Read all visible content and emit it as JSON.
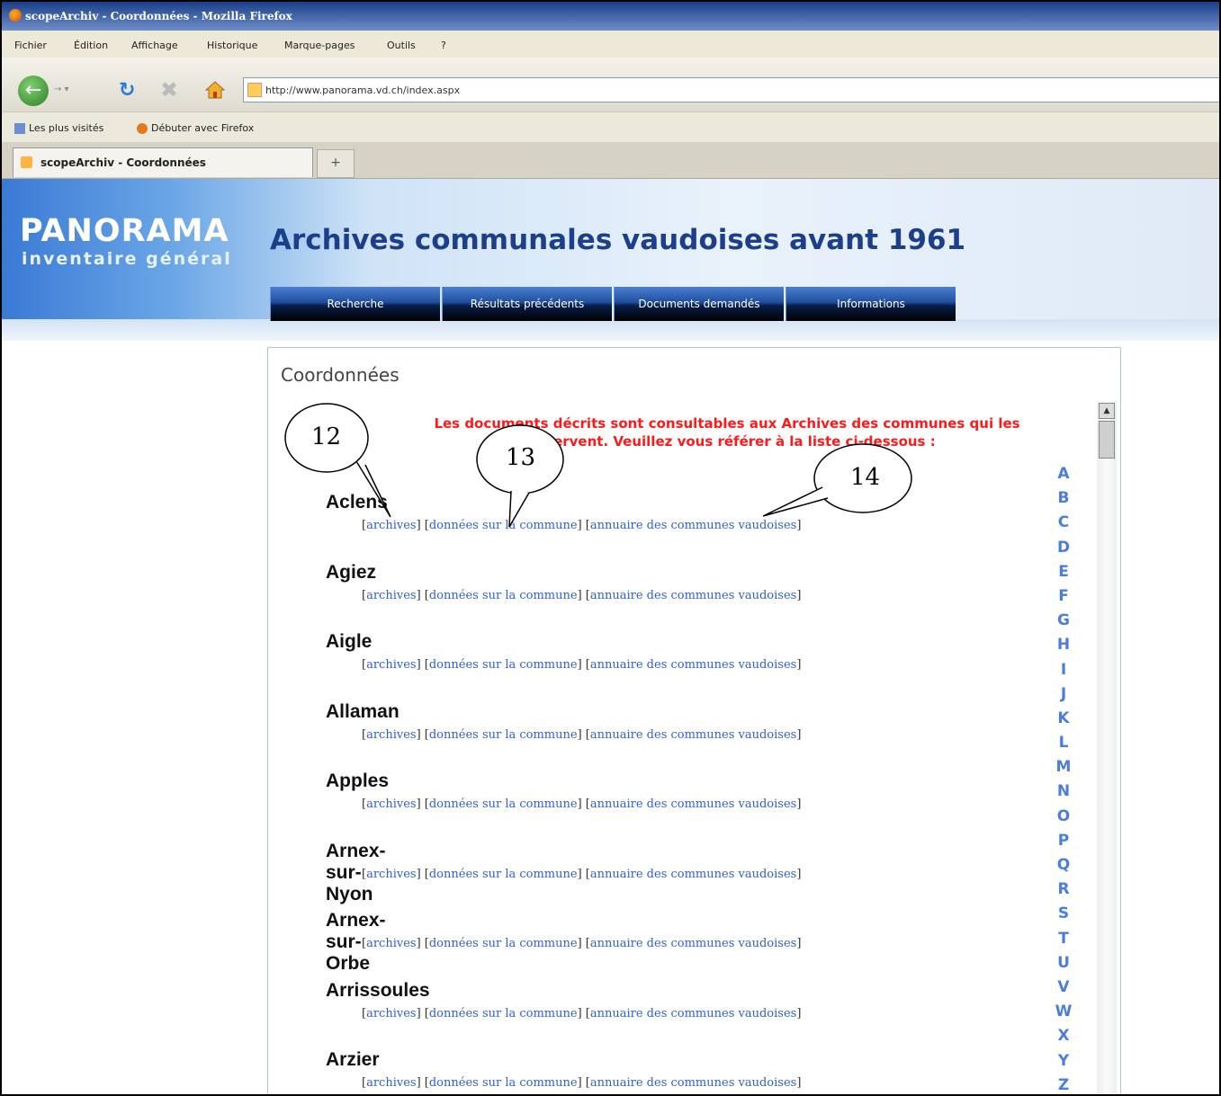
{
  "browser": {
    "window_title": "scopeArchiv - Coordonnées - Mozilla Firefox",
    "menu": [
      "Fichier",
      "Édition",
      "Affichage",
      "Historique",
      "Marque-pages",
      "Outils",
      "?"
    ],
    "url": "http://www.panorama.vd.ch/index.aspx",
    "bookmarks": [
      "Les plus visités",
      "Débuter avec Firefox"
    ],
    "tab_label": "scopeArchiv - Coordonnées",
    "new_tab": "+"
  },
  "site": {
    "logo_title": "PANORAMA",
    "logo_subtitle": "inventaire général",
    "title": "Archives communales vaudoises avant 1961",
    "nav": [
      "Recherche",
      "Résultats précédents",
      "Documents demandés",
      "Informations"
    ]
  },
  "content": {
    "section_title": "Coordonnées",
    "notice_line1": "Les documents décrits sont consultables aux Archives des communes qui les",
    "notice_line2": "conservent. Veuillez vous référer à la liste ci-dessous :",
    "link_labels": {
      "archives": "archives",
      "donnees": "données sur la commune",
      "annuaire": "annuaire des communes vaudoises"
    },
    "communes": [
      "Aclens",
      "Agiez",
      "Aigle",
      "Allaman",
      "Apples",
      "Arnex-sur-Nyon",
      "Arnex-sur-Orbe",
      "Arrissoules",
      "Arzier"
    ],
    "alphabet": [
      "A",
      "B",
      "C",
      "D",
      "E",
      "F",
      "G",
      "H",
      "I",
      "J",
      "K",
      "L",
      "M",
      "N",
      "O",
      "P",
      "Q",
      "R",
      "S",
      "T",
      "U",
      "V",
      "W",
      "X",
      "Y",
      "Z"
    ]
  },
  "callouts": [
    "12",
    "13",
    "14"
  ]
}
